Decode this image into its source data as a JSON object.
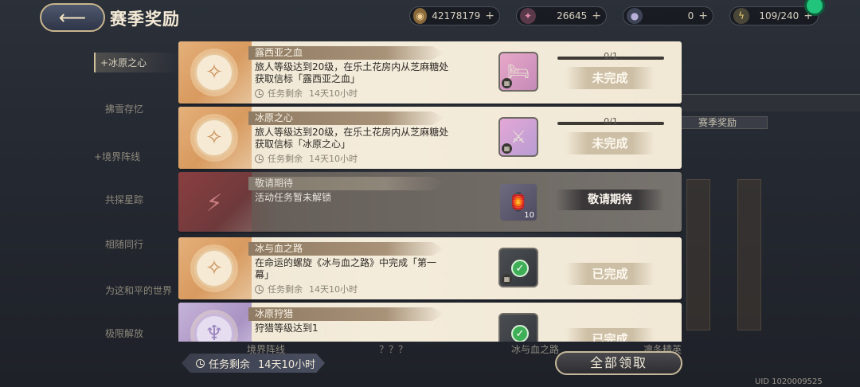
{
  "header": {
    "title": "赛季奖励",
    "resources": [
      {
        "icon": "coin-icon",
        "value": "42178179"
      },
      {
        "icon": "star-crystal-icon",
        "value": "26645"
      },
      {
        "icon": "orb-icon",
        "value": "0"
      },
      {
        "icon": "lightning-icon",
        "value": "109/240"
      }
    ]
  },
  "left_menu": [
    {
      "label": "冰原之心",
      "active": true
    },
    {
      "label": "拂雪存忆"
    },
    {
      "label": "境界阵线"
    },
    {
      "label": "共探星踪"
    },
    {
      "label": "相随同行"
    },
    {
      "label": "为这和平的世界"
    },
    {
      "label": "极限解放"
    }
  ],
  "background_text": {
    "tab": "赛季奖励",
    "labels": [
      "境界阵线",
      "？？？",
      "冰与血之路",
      "凛冬精英"
    ]
  },
  "tasks": [
    {
      "title": "露西亚之血",
      "desc": "旅人等级达到20级，在乐土花房内从芝麻糖处获取信标「露西亚之血」",
      "timer_label": "任务剩余",
      "timer_value": "14天10小时",
      "progress": "0/1",
      "status": "未完成",
      "reward_icon": "bed-icon"
    },
    {
      "title": "冰原之心",
      "desc": "旅人等级达到20级，在乐土花房内从芝麻糖处获取信标「冰原之心」",
      "timer_label": "任务剩余",
      "timer_value": "14天10小时",
      "progress": "0/1",
      "status": "未完成",
      "reward_icon": "shield-decoration-icon"
    },
    {
      "title": "敬请期待",
      "desc": "活动任务暂未解锁",
      "status": "敬请期待",
      "reward_icon": "lantern-icon",
      "reward_count": "10"
    },
    {
      "title": "冰与血之路",
      "desc": "在命运的螺旋《冰与血之路》中完成「第一幕」",
      "timer_label": "任务剩余",
      "timer_value": "14天10小时",
      "status": "已完成",
      "reward_icon": "check-icon"
    },
    {
      "title": "冰原狩猎",
      "desc": "狩猎等级达到1",
      "status": "已完成",
      "reward_icon": "check-icon"
    }
  ],
  "footer": {
    "timer_label": "任务剩余",
    "timer_value": "14天10小时",
    "claim_all": "全部领取",
    "uid": "UID 1020009525"
  },
  "colors": {
    "accent_gold": "#c9b58c",
    "card_bg": "#f4ecdb",
    "complete_green": "#3faf57"
  }
}
